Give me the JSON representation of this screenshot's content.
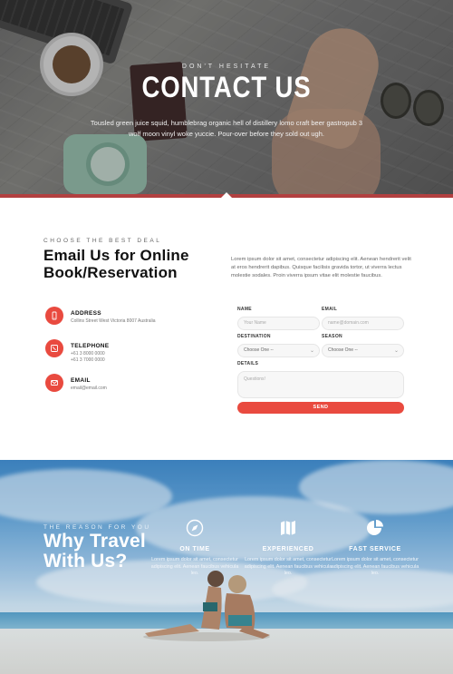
{
  "hero": {
    "kicker": "DON'T HESITATE",
    "title": "CONTACT US",
    "text": "Tousled green juice squid, humblebrag organic hell of distillery lomo craft beer gastropub 3 wolf moon vinyl woke yuccie. Pour-over before they sold out ugh."
  },
  "contact": {
    "kicker": "CHOOSE THE BEST DEAL",
    "title": "Email Us for Online Book/Reservation",
    "description": "Lorem ipsum dolor sit amet, consectetur adipiscing elit. Aenean hendrerit velit at eros hendrerit dapibus. Quisque facilisis gravida tortor, ut viverra lectus molestie sodales. Proin viverra ipsum vitae elit molestie faucibus.",
    "info": [
      {
        "label": "ADDRESS",
        "icon": "phone-device-icon",
        "lines": [
          "Collins Street West Victoria 8007 Australia"
        ]
      },
      {
        "label": "TELEPHONE",
        "icon": "phone-icon",
        "lines": [
          "+61 3 8000 0000",
          "+61 3 7000 0000"
        ]
      },
      {
        "label": "EMAIL",
        "icon": "envelope-icon",
        "lines": [
          "email@email.com"
        ]
      }
    ]
  },
  "form": {
    "name_label": "NAME",
    "name_placeholder": "Your Name",
    "email_label": "EMAIL",
    "email_placeholder": "name@domain.com",
    "destination_label": "DESTINATION",
    "destination_value": "Choose One --",
    "season_label": "SEASON",
    "season_value": "Choose One --",
    "details_label": "DETAILS",
    "details_placeholder": "Questions!",
    "send_label": "SEND"
  },
  "why": {
    "kicker": "THE REASON FOR YOU",
    "title": "Why Travel With Us?",
    "features": [
      {
        "title": "ON TIME",
        "icon": "compass-icon",
        "text": "Lorem ipsum dolor sit amet, consectetur adipiscing elit. Aenean faucibus vehicula leo."
      },
      {
        "title": "EXPERIENCED",
        "icon": "map-icon",
        "text": "Lorem ipsum dolor sit amet, consectetur adipiscing elit. Aenean faucibus vehicula leo."
      },
      {
        "title": "FAST SERVICE",
        "icon": "pie-chart-icon",
        "text": "Lorem ipsum dolor sit amet, consectetur adipiscing elit. Aenean faucibus vehicula leo."
      }
    ]
  },
  "colors": {
    "accent": "#e94a3f"
  }
}
